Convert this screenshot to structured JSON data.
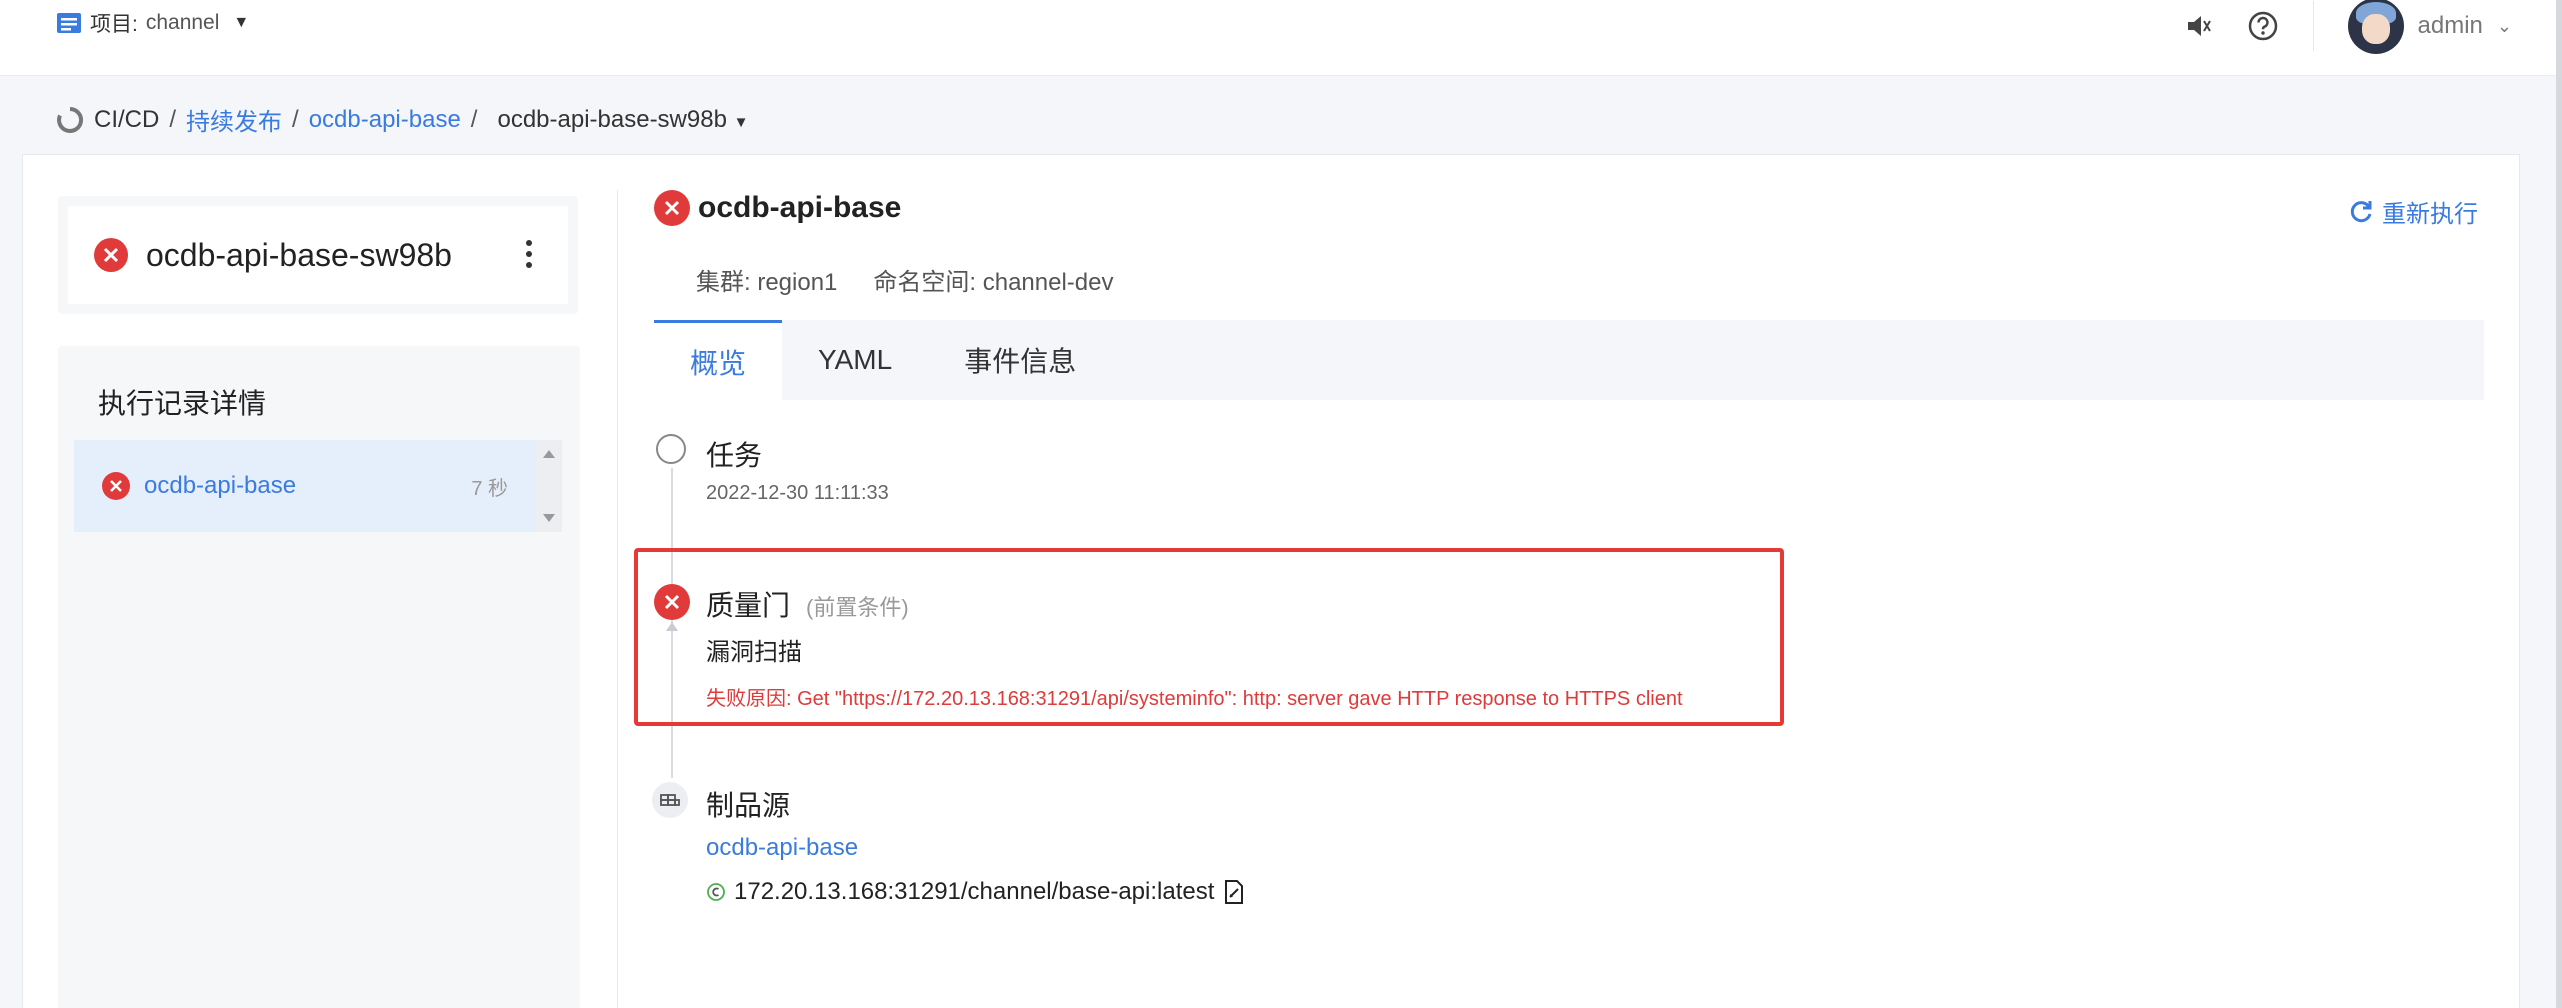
{
  "header": {
    "project_label": "项目:",
    "project_name": "channel",
    "user_name": "admin"
  },
  "breadcrumb": {
    "root": "CI/CD",
    "sep": "/",
    "items": [
      "持续发布",
      "ocdb-api-base"
    ],
    "current": "ocdb-api-base-sw98b"
  },
  "left": {
    "run_title": "ocdb-api-base-sw98b",
    "section_title": "执行记录详情",
    "runs": [
      {
        "name": "ocdb-api-base",
        "duration": "7 秒",
        "status": "failed"
      }
    ]
  },
  "detail": {
    "title": "ocdb-api-base",
    "rerun_label": "重新执行",
    "cluster": "集群: region1",
    "namespace": "命名空间: channel-dev",
    "tabs": [
      "概览",
      "YAML",
      "事件信息"
    ],
    "active_tab": "概览"
  },
  "timeline": {
    "task": {
      "title": "任务",
      "time": "2022-12-30 11:11:33"
    },
    "quality_gate": {
      "title": "质量门",
      "tag": "(前置条件)",
      "subtitle": "漏洞扫描",
      "reason": "失败原因: Get \"https://172.20.13.168:31291/api/systeminfo\": http: server gave HTTP response to HTTPS client"
    },
    "artifact": {
      "title": "制品源",
      "name": "ocdb-api-base",
      "image": "172.20.13.168:31291/channel/base-api:latest"
    }
  },
  "colors": {
    "accent": "#3a7be0",
    "error": "#e03a3a",
    "highlight_box": "#e53935"
  }
}
